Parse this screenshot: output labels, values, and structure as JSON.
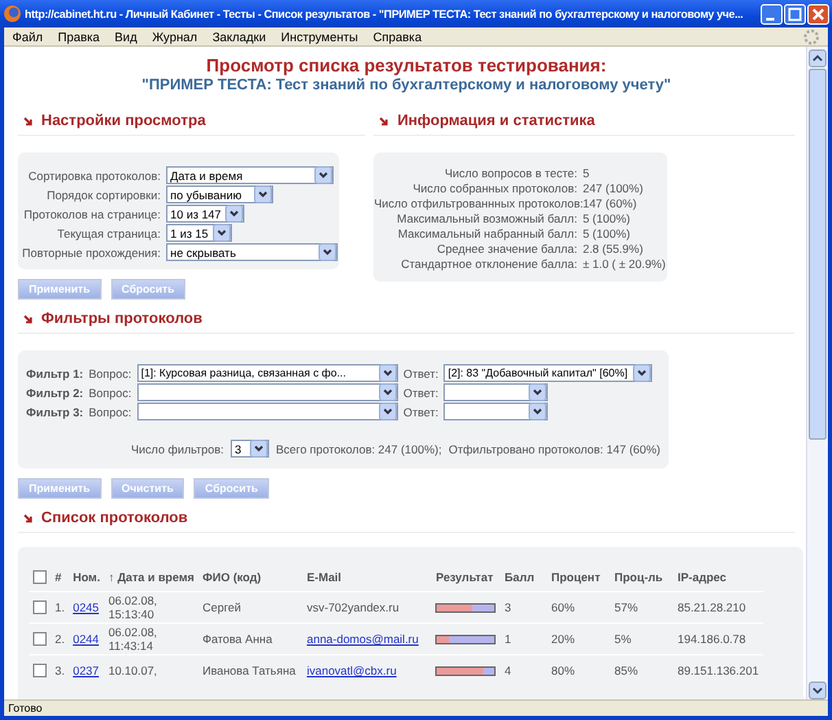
{
  "window": {
    "title": "http://cabinet.ht.ru - Личный Кабинет - Тесты - Список результатов - \"ПРИМЕР ТЕСТА: Тест знаний по бухгалтерскому и налоговому уче..."
  },
  "menu": [
    "Файл",
    "Правка",
    "Вид",
    "Журнал",
    "Закладки",
    "Инструменты",
    "Справка"
  ],
  "page": {
    "title": "Просмотр списка результатов тестирования:",
    "subtitle": "\"ПРИМЕР ТЕСТА: Тест знаний по бухгалтерскому и налоговому учету\""
  },
  "settings": {
    "heading": "Настройки просмотра",
    "fields": [
      {
        "label": "Сортировка протоколов:",
        "value": "Дата и время"
      },
      {
        "label": "Порядок сортировки:",
        "value": "по убыванию"
      },
      {
        "label": "Протоколов на странице:",
        "value": "10 из 147"
      },
      {
        "label": "Текущая страница:",
        "value": "1 из 15"
      },
      {
        "label": "Повторные прохождения:",
        "value": "не скрывать"
      }
    ],
    "buttons": [
      "Применить",
      "Сбросить"
    ]
  },
  "info": {
    "heading": "Информация и статистика",
    "rows": [
      {
        "label": "Число вопросов в тесте:",
        "value": "5"
      },
      {
        "label": "Число собранных протоколов:",
        "value": "247 (100%)"
      },
      {
        "label": "Число отфильтрованнных протоколов:",
        "value": "147 (60%)"
      },
      {
        "label": "Максимальный возможный балл:",
        "value": "5 (100%)"
      },
      {
        "label": "Максимальный набранный балл:",
        "value": "5 (100%)"
      },
      {
        "label": "Среднее значение балла:",
        "value": "2.8 (55.9%)"
      },
      {
        "label": "Стандартное отклонение балла:",
        "value": "± 1.0 ( ± 20.9%)"
      }
    ]
  },
  "filters": {
    "heading": "Фильтры протоколов",
    "rows": [
      {
        "label": "Фильтр 1:",
        "question_label": "Вопрос:",
        "question": "[1]: Курсовая разница, связанная с фо...",
        "answer_label": "Ответ:",
        "answer": "[2]: 83 \"Добавочный капитал\" [60%]"
      },
      {
        "label": "Фильтр 2:",
        "question_label": "Вопрос:",
        "answer_label": "Ответ:"
      },
      {
        "label": "Фильтр 3:",
        "question_label": "Вопрос:",
        "answer_label": "Ответ:"
      }
    ],
    "count_label": "Число фильтров:",
    "count": "3",
    "total": "Всего протоколов: 247 (100%);",
    "filtered": "Отфильтровано протоколов: 147 (60%)",
    "buttons": [
      "Применить",
      "Очистить",
      "Сбросить"
    ]
  },
  "protocols": {
    "heading": "Список протоколов",
    "select_all_checked": false,
    "columns": [
      "#",
      "Ном.",
      "↑ Дата и время",
      "ФИО (код)",
      "E-Mail",
      "Результат",
      "Балл",
      "Процент",
      "Проц-ль",
      "IP-адрес"
    ],
    "rows": [
      {
        "checked": false,
        "index": "1.",
        "number": "0245",
        "date": "06.02.08, 15:13:40",
        "name": "Сергей",
        "email": "vsv-702yandex.ru",
        "email_link": false,
        "level": 0.6,
        "score": "3",
        "percent": "60%",
        "percentile": "57%",
        "ip": "85.21.28.210"
      },
      {
        "checked": false,
        "index": "2.",
        "number": "0244",
        "date": "06.02.08, 11:43:14",
        "name": "Фатова Анна",
        "email": "anna-domos@mail.ru",
        "email_link": true,
        "level": 0.2,
        "score": "1",
        "percent": "20%",
        "percentile": "5%",
        "ip": "194.186.0.78"
      },
      {
        "checked": false,
        "index": "3.",
        "number": "0237",
        "date": "10.10.07,",
        "name": "Иванова Татьяна",
        "email": "ivanovatl@cbx.ru",
        "email_link": true,
        "level": 0.8,
        "score": "4",
        "percent": "80%",
        "percentile": "85%",
        "ip": "89.151.136.201"
      }
    ]
  },
  "status_bar": "Готово"
}
